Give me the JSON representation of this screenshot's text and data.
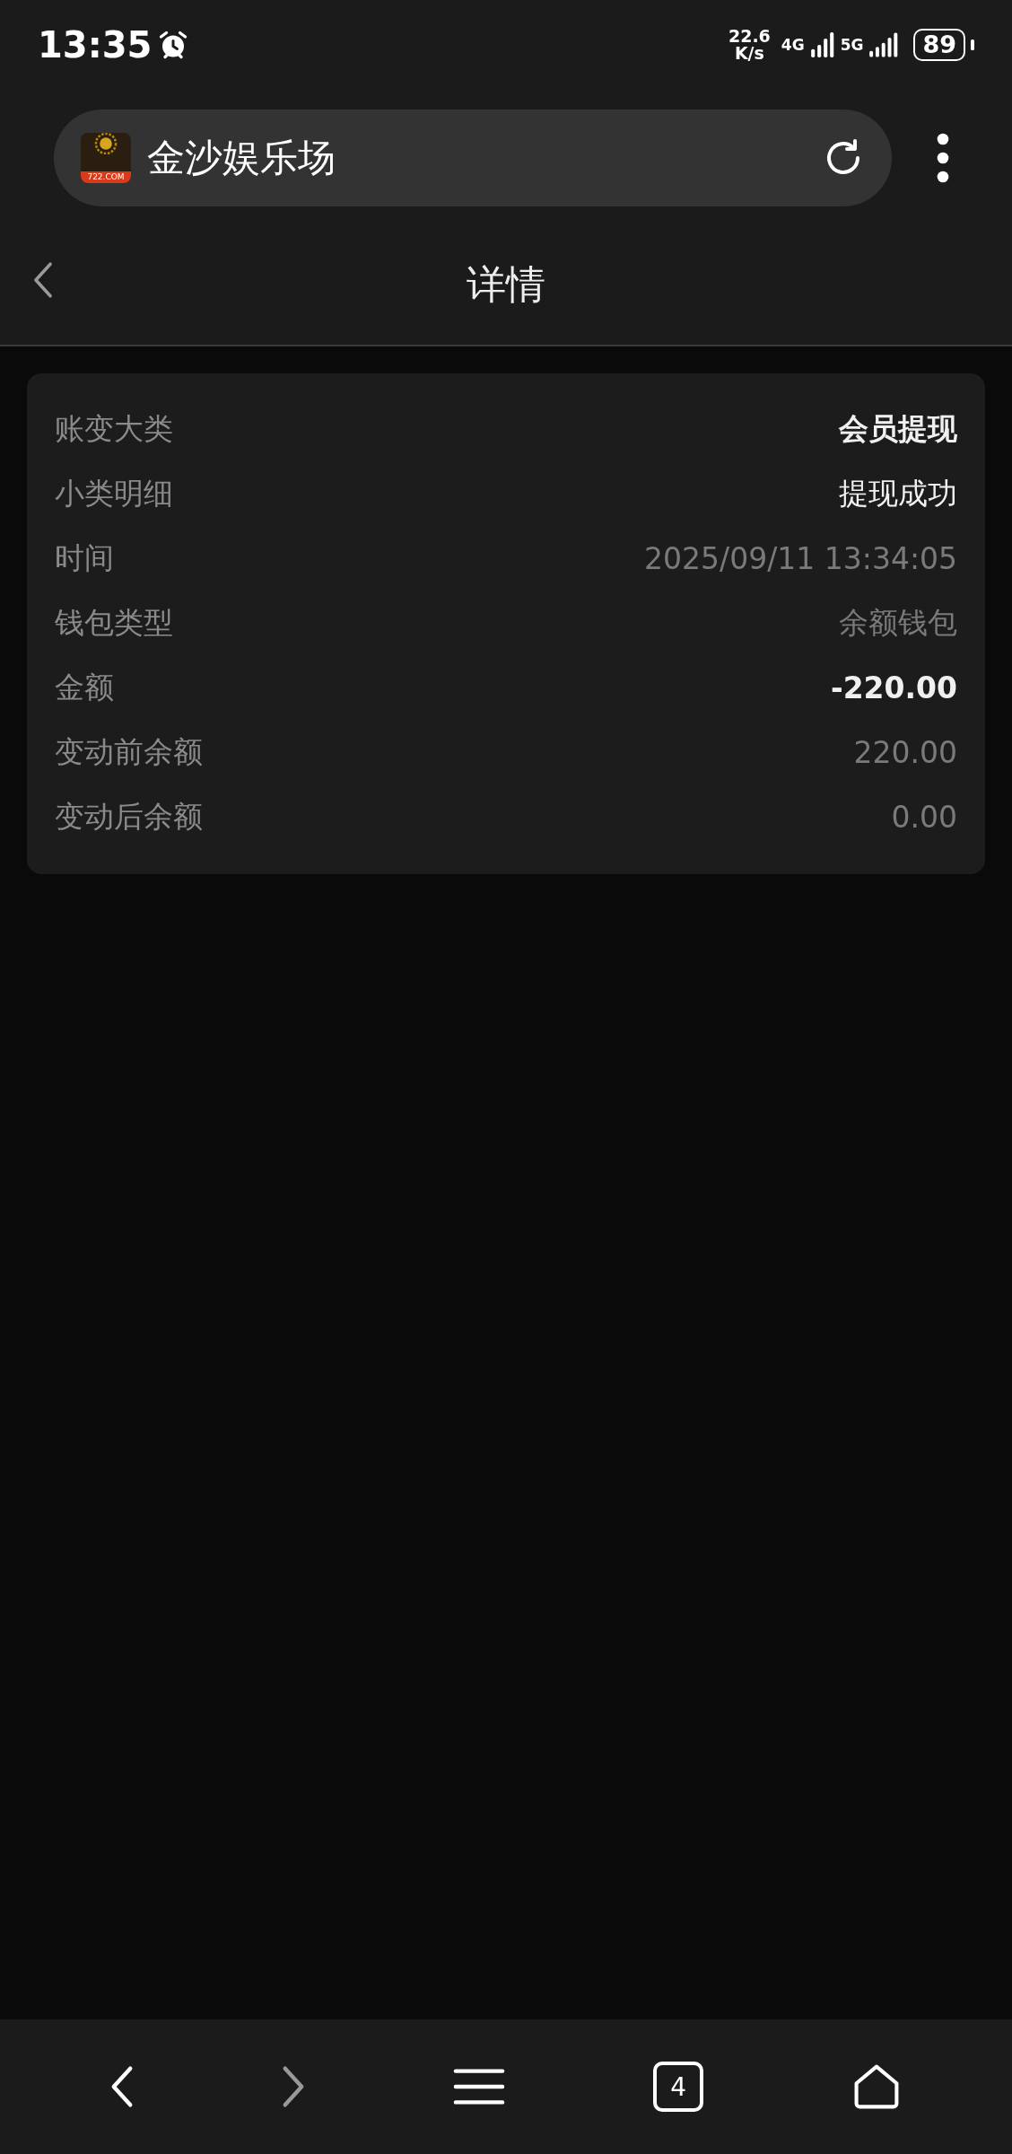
{
  "status_bar": {
    "time": "13:35",
    "speed": "22.6",
    "speed_unit": "K/s",
    "network_1": "4G",
    "network_2": "5G",
    "battery": "89"
  },
  "address_bar": {
    "title": "金沙娱乐场",
    "favicon_text": "722.COM"
  },
  "header": {
    "title": "详情"
  },
  "details": [
    {
      "label": "账变大类",
      "value": "会员提现",
      "kind": "strong"
    },
    {
      "label": "小类明细",
      "value": "提现成功",
      "kind": "plain"
    },
    {
      "label": "时间",
      "value": "2025/09/11 13:34:05",
      "kind": "muted"
    },
    {
      "label": "钱包类型",
      "value": "余额钱包",
      "kind": "muted"
    },
    {
      "label": "金额",
      "value": "-220.00",
      "kind": "strong"
    },
    {
      "label": "变动前余额",
      "value": "220.00",
      "kind": "muted"
    },
    {
      "label": "变动后余额",
      "value": "0.00",
      "kind": "muted"
    }
  ],
  "bottom_nav": [
    {
      "kind": "back",
      "disabled": false
    },
    {
      "kind": "forward",
      "disabled": true
    },
    {
      "kind": "menu",
      "disabled": false
    },
    {
      "kind": "tabs",
      "count": "4",
      "disabled": false
    },
    {
      "kind": "home",
      "disabled": false
    }
  ]
}
